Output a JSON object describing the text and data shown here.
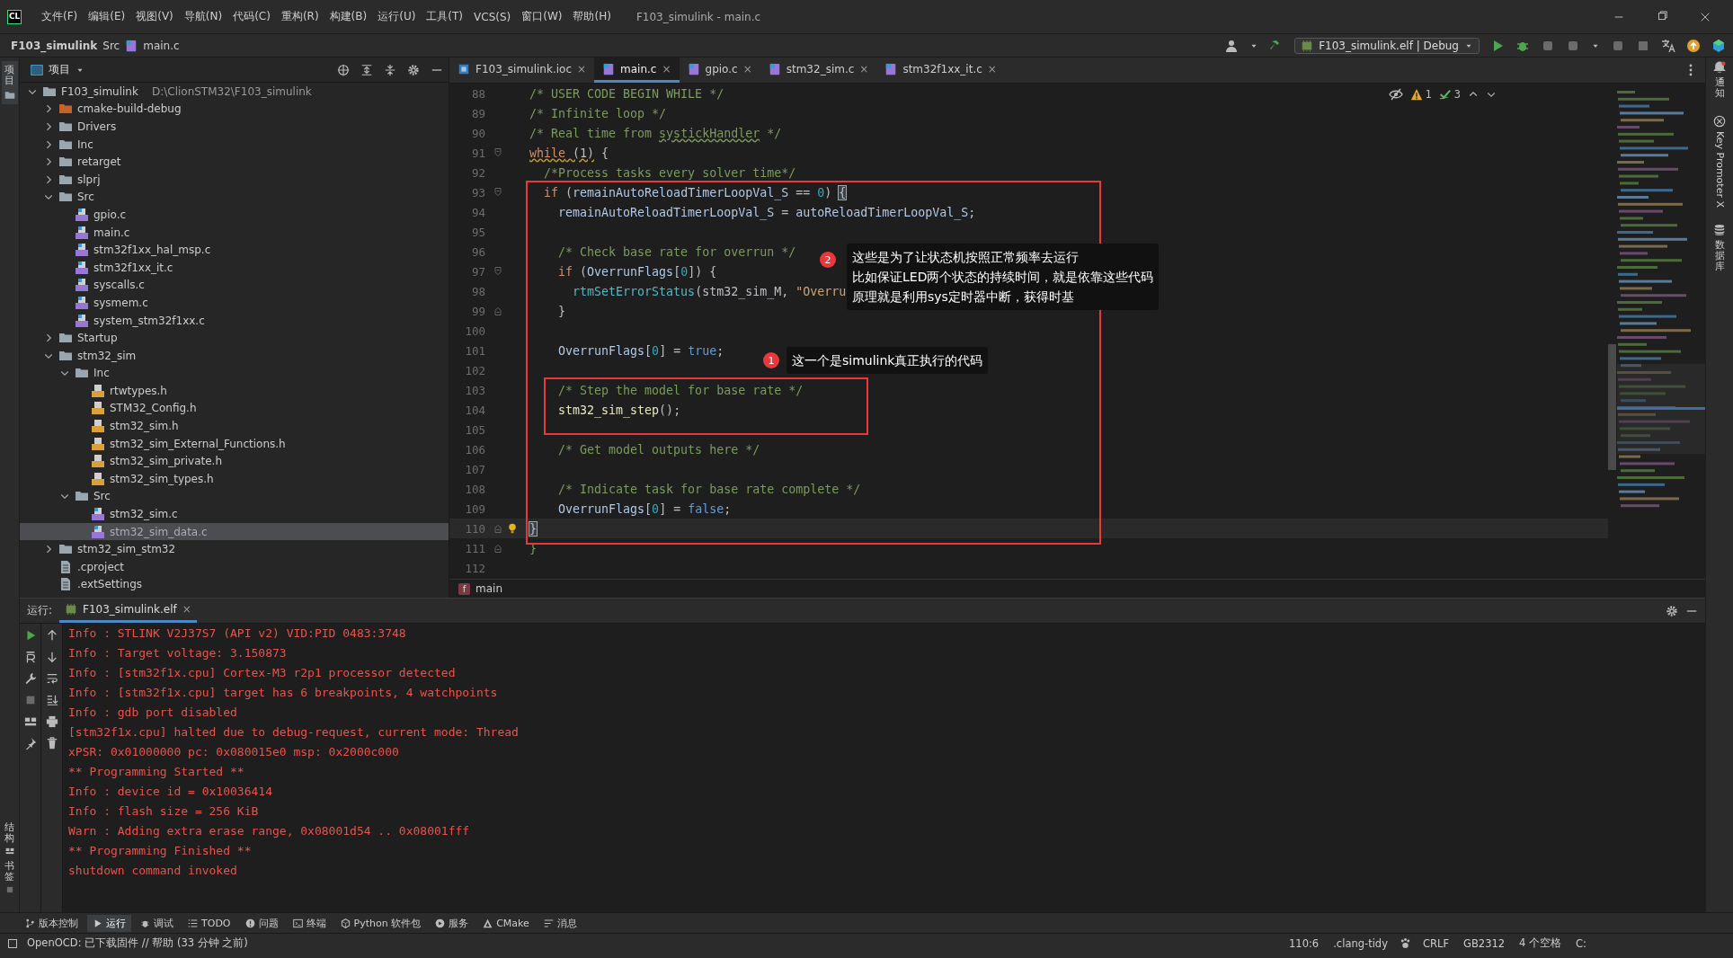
{
  "window": {
    "app_logo": "CL",
    "menu": [
      "文件(F)",
      "编辑(E)",
      "视图(V)",
      "导航(N)",
      "代码(C)",
      "重构(R)",
      "构建(B)",
      "运行(U)",
      "工具(T)",
      "VCS(S)",
      "窗口(W)",
      "帮助(H)"
    ],
    "title": "F103_simulink - main.c"
  },
  "navigation": {
    "breadcrumb": [
      "F103_simulink",
      "Src",
      "main.c"
    ],
    "run_config": "F103_simulink.elf | Debug"
  },
  "left_stripe": {
    "top": "项目",
    "bottom": [
      "结构",
      "书签"
    ]
  },
  "right_stripe": [
    "通知",
    "Key Promoter X",
    "数据库"
  ],
  "project": {
    "title": "项目",
    "tree": [
      {
        "name": "F103_simulink",
        "path": "D:\\ClionSTM32\\F103_simulink",
        "kind": "folder",
        "expanded": true,
        "selected": false,
        "children": [
          {
            "name": "cmake-build-debug",
            "kind": "build_folder",
            "expanded": false,
            "selected": false
          },
          {
            "name": "Drivers",
            "kind": "folder",
            "expanded": false,
            "selected": false
          },
          {
            "name": "Inc",
            "kind": "folder",
            "expanded": false,
            "selected": false
          },
          {
            "name": "retarget",
            "kind": "folder",
            "expanded": false,
            "selected": false
          },
          {
            "name": "slprj",
            "kind": "folder",
            "expanded": false,
            "selected": false
          },
          {
            "name": "Src",
            "kind": "folder",
            "expanded": true,
            "selected": false,
            "children": [
              {
                "name": "gpio.c",
                "kind": "c_file",
                "selected": false
              },
              {
                "name": "main.c",
                "kind": "c_file",
                "selected": false
              },
              {
                "name": "stm32f1xx_hal_msp.c",
                "kind": "c_file",
                "selected": false
              },
              {
                "name": "stm32f1xx_it.c",
                "kind": "c_file",
                "selected": false
              },
              {
                "name": "syscalls.c",
                "kind": "c_file",
                "selected": false
              },
              {
                "name": "sysmem.c",
                "kind": "c_file",
                "selected": false
              },
              {
                "name": "system_stm32f1xx.c",
                "kind": "c_file",
                "selected": false
              }
            ]
          },
          {
            "name": "Startup",
            "kind": "folder",
            "expanded": false,
            "selected": false
          },
          {
            "name": "stm32_sim",
            "kind": "folder",
            "expanded": true,
            "selected": false,
            "children": [
              {
                "name": "Inc",
                "kind": "folder",
                "expanded": true,
                "selected": false,
                "children": [
                  {
                    "name": "rtwtypes.h",
                    "kind": "h_file",
                    "selected": false
                  },
                  {
                    "name": "STM32_Config.h",
                    "kind": "h_file",
                    "selected": false
                  },
                  {
                    "name": "stm32_sim.h",
                    "kind": "h_file",
                    "selected": false
                  },
                  {
                    "name": "stm32_sim_External_Functions.h",
                    "kind": "h_file",
                    "selected": false
                  },
                  {
                    "name": "stm32_sim_private.h",
                    "kind": "h_file",
                    "selected": false
                  },
                  {
                    "name": "stm32_sim_types.h",
                    "kind": "h_file",
                    "selected": false
                  }
                ]
              },
              {
                "name": "Src",
                "kind": "folder",
                "expanded": true,
                "selected": false,
                "children": [
                  {
                    "name": "stm32_sim.c",
                    "kind": "c_file",
                    "selected": false
                  },
                  {
                    "name": "stm32_sim_data.c",
                    "kind": "c_file",
                    "selected": true
                  }
                ]
              }
            ]
          },
          {
            "name": "stm32_sim_stm32",
            "kind": "folder",
            "expanded": false,
            "selected": false
          },
          {
            "name": ".cproject",
            "kind": "file",
            "selected": false
          },
          {
            "name": ".extSettings",
            "kind": "file",
            "selected": false
          }
        ]
      }
    ]
  },
  "editor": {
    "tabs": [
      {
        "label": "F103_simulink.ioc",
        "kind": "ioc",
        "close": "×",
        "selected": false
      },
      {
        "label": "main.c",
        "kind": "c",
        "close": "×",
        "selected": true
      },
      {
        "label": "gpio.c",
        "kind": "c",
        "close": "×",
        "selected": false
      },
      {
        "label": "stm32_sim.c",
        "kind": "c",
        "close": "×",
        "selected": false
      },
      {
        "label": "stm32f1xx_it.c",
        "kind": "c",
        "close": "×",
        "selected": false
      }
    ],
    "inspections": {
      "warnings": "1",
      "passed": "3"
    },
    "lines": [
      {
        "number": "88",
        "fold_start": false,
        "fold_end": false,
        "current": false,
        "bulb": false,
        "tokens": [
          {
            "kind": "comment",
            "text": "/* USER CODE BEGIN WHILE */"
          }
        ]
      },
      {
        "number": "89",
        "fold_start": false,
        "fold_end": false,
        "current": false,
        "bulb": false,
        "tokens": [
          {
            "kind": "comment",
            "text": "/* Infinite loop */"
          }
        ]
      },
      {
        "number": "90",
        "fold_start": false,
        "fold_end": false,
        "current": false,
        "bulb": false,
        "tokens": [
          {
            "kind": "comment",
            "text": "/* Real time from "
          },
          {
            "kind": "comment_typo",
            "text": "systickHandler"
          },
          {
            "kind": "comment",
            "text": " */"
          }
        ]
      },
      {
        "number": "91",
        "fold_start": true,
        "fold_end": false,
        "current": false,
        "bulb": false,
        "tokens": [
          {
            "kind": "keyword_warning",
            "text": "while"
          },
          {
            "kind": "plain_warning",
            "text": " (1)"
          },
          {
            "kind": "plain",
            "text": " {"
          }
        ]
      },
      {
        "number": "92",
        "fold_start": false,
        "fold_end": false,
        "current": false,
        "bulb": false,
        "tokens": [
          {
            "kind": "comment",
            "text": "  /*Process tasks every solver time*/"
          }
        ]
      },
      {
        "number": "93",
        "fold_start": true,
        "fold_end": false,
        "current": false,
        "bulb": false,
        "tokens": [
          {
            "kind": "keyword",
            "text": "  if"
          },
          {
            "kind": "plain",
            "text": " ("
          },
          {
            "kind": "variable",
            "text": "remainAutoReloadTimerLoopVal_S"
          },
          {
            "kind": "plain",
            "text": " == "
          },
          {
            "kind": "number",
            "text": "0"
          },
          {
            "kind": "plain",
            "text": ") "
          },
          {
            "kind": "brace_match",
            "text": "{"
          }
        ]
      },
      {
        "number": "94",
        "fold_start": false,
        "fold_end": false,
        "current": false,
        "bulb": false,
        "tokens": [
          {
            "kind": "variable",
            "text": "    remainAutoReloadTimerLoopVal_S"
          },
          {
            "kind": "plain",
            "text": " = "
          },
          {
            "kind": "variable",
            "text": "autoReloadTimerLoopVal_S"
          },
          {
            "kind": "plain",
            "text": ";"
          }
        ]
      },
      {
        "number": "95",
        "fold_start": false,
        "fold_end": false,
        "current": false,
        "bulb": false
      },
      {
        "number": "96",
        "fold_start": false,
        "fold_end": false,
        "current": false,
        "bulb": false,
        "tokens": [
          {
            "kind": "comment",
            "text": "    /* Check base rate for overrun */"
          }
        ]
      },
      {
        "number": "97",
        "fold_start": true,
        "fold_end": false,
        "current": false,
        "bulb": false,
        "tokens": [
          {
            "kind": "keyword",
            "text": "    if"
          },
          {
            "kind": "plain",
            "text": " ("
          },
          {
            "kind": "variable",
            "text": "OverrunFlags"
          },
          {
            "kind": "plain",
            "text": "["
          },
          {
            "kind": "number",
            "text": "0"
          },
          {
            "kind": "plain",
            "text": "]) {"
          }
        ]
      },
      {
        "number": "98",
        "fold_start": false,
        "fold_end": false,
        "current": false,
        "bulb": false,
        "tokens": [
          {
            "kind": "call",
            "text": "      rtmSetErrorStatus"
          },
          {
            "kind": "plain",
            "text": "(stm32_sim_M, "
          },
          {
            "kind": "string",
            "text": "\"Overru"
          }
        ]
      },
      {
        "number": "99",
        "fold_start": false,
        "fold_end": true,
        "current": false,
        "bulb": false,
        "tokens": [
          {
            "kind": "brace",
            "text": "    }"
          }
        ]
      },
      {
        "number": "100",
        "fold_start": false,
        "fold_end": false,
        "current": false,
        "bulb": false
      },
      {
        "number": "101",
        "fold_start": false,
        "fold_end": false,
        "current": false,
        "bulb": false,
        "tokens": [
          {
            "kind": "variable",
            "text": "    OverrunFlags"
          },
          {
            "kind": "plain",
            "text": "["
          },
          {
            "kind": "number",
            "text": "0"
          },
          {
            "kind": "plain",
            "text": "] = "
          },
          {
            "kind": "literal",
            "text": "true"
          },
          {
            "kind": "plain",
            "text": ";"
          }
        ]
      },
      {
        "number": "102",
        "fold_start": false,
        "fold_end": false,
        "current": false,
        "bulb": false
      },
      {
        "number": "103",
        "fold_start": false,
        "fold_end": false,
        "current": false,
        "bulb": false,
        "tokens": [
          {
            "kind": "comment",
            "text": "    /* Step the model for base rate */"
          }
        ]
      },
      {
        "number": "104",
        "fold_start": false,
        "fold_end": false,
        "current": false,
        "bulb": false,
        "tokens": [
          {
            "kind": "function",
            "text": "    stm32_sim_step"
          },
          {
            "kind": "brace",
            "text": "()"
          },
          {
            "kind": "plain",
            "text": ";"
          }
        ]
      },
      {
        "number": "105",
        "fold_start": false,
        "fold_end": false,
        "current": false,
        "bulb": false
      },
      {
        "number": "106",
        "fold_start": false,
        "fold_end": false,
        "current": false,
        "bulb": false,
        "tokens": [
          {
            "kind": "comment",
            "text": "    /* Get model outputs here */"
          }
        ]
      },
      {
        "number": "107",
        "fold_start": false,
        "fold_end": false,
        "current": false,
        "bulb": false
      },
      {
        "number": "108",
        "fold_start": false,
        "fold_end": false,
        "current": false,
        "bulb": false,
        "tokens": [
          {
            "kind": "comment",
            "text": "    /* Indicate task for base rate complete */"
          }
        ]
      },
      {
        "number": "109",
        "fold_start": false,
        "fold_end": false,
        "current": false,
        "bulb": false,
        "tokens": [
          {
            "kind": "variable",
            "text": "    OverrunFlags"
          },
          {
            "kind": "plain",
            "text": "["
          },
          {
            "kind": "number",
            "text": "0"
          },
          {
            "kind": "plain",
            "text": "] = "
          },
          {
            "kind": "literal",
            "text": "false"
          },
          {
            "kind": "plain",
            "text": ";"
          }
        ]
      },
      {
        "number": "110",
        "fold_start": false,
        "fold_end": true,
        "current": true,
        "bulb": true,
        "tokens": [
          {
            "kind": "brace_match",
            "text": "}"
          }
        ]
      },
      {
        "number": "111",
        "fold_start": false,
        "fold_end": true,
        "current": false,
        "bulb": false,
        "tokens": [
          {
            "kind": "comment",
            "text": "}"
          }
        ]
      },
      {
        "number": "112",
        "fold_start": false,
        "fold_end": false,
        "current": false,
        "bulb": false
      }
    ],
    "annotations": [
      {
        "badge": "2",
        "text": [
          "这些是为了让状态机按照正常频率去运行",
          "比如保证LED两个状态的持续时间，就是依靠这些代码",
          "原理就是利用sys定时器中断，获得时基"
        ]
      },
      {
        "badge": "1",
        "text": [
          "这一个是simulink真正执行的代码"
        ]
      }
    ],
    "breadcrumb": {
      "badge": "f",
      "label": "main"
    }
  },
  "run": {
    "label": "运行:",
    "tab": "F103_simulink.elf",
    "close": "×",
    "output": [
      "Info : STLINK V2J37S7 (API v2) VID:PID 0483:3748",
      "Info : Target voltage: 3.150873",
      "Info : [stm32f1x.cpu] Cortex-M3 r2p1 processor detected",
      "Info : [stm32f1x.cpu] target has 6 breakpoints, 4 watchpoints",
      "Info : gdb port disabled",
      "[stm32f1x.cpu] halted due to debug-request, current mode: Thread",
      "xPSR: 0x01000000 pc: 0x080015e0 msp: 0x2000c000",
      "** Programming Started **",
      "Info : device id = 0x10036414",
      "Info : flash size = 256 KiB",
      "Warn : Adding extra erase range, 0x08001d54 .. 0x08001fff",
      "** Programming Finished **",
      "shutdown command invoked"
    ]
  },
  "tool_windows": [
    {
      "label": "版本控制",
      "kind": "vcs",
      "selected": false
    },
    {
      "label": "运行",
      "kind": "run",
      "selected": true
    },
    {
      "label": "调试",
      "kind": "debug",
      "selected": false
    },
    {
      "label": "TODO",
      "kind": "todo",
      "selected": false
    },
    {
      "label": "问题",
      "kind": "problems",
      "selected": false
    },
    {
      "label": "终端",
      "kind": "terminal",
      "selected": false
    },
    {
      "label": "Python 软件包",
      "kind": "python",
      "selected": false
    },
    {
      "label": "服务",
      "kind": "services",
      "selected": false
    },
    {
      "label": "CMake",
      "kind": "cmake",
      "selected": false
    },
    {
      "label": "消息",
      "kind": "messages",
      "selected": false
    }
  ],
  "status_bar": {
    "message": "OpenOCD: 已下载固件 // 帮助 (33 分钟 之前)",
    "items": [
      "110:6",
      ".clang-tidy",
      "CRLF",
      "GB2312",
      "4 个空格",
      "C:"
    ]
  }
}
